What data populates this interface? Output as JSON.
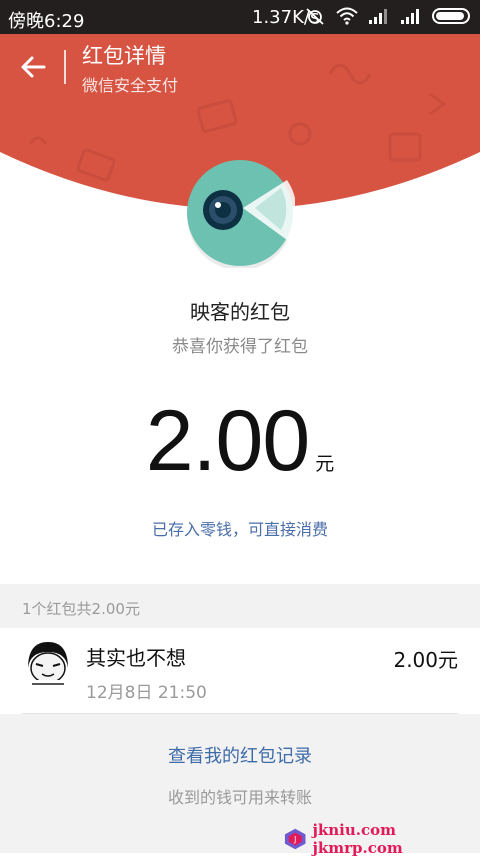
{
  "status_bar": {
    "time": "傍晚6:29",
    "network_speed": "1.37K/s",
    "icons": [
      "alarm-off-icon",
      "wifi-icon",
      "signal-icon",
      "signal-icon",
      "battery-icon"
    ]
  },
  "header": {
    "title": "红包详情",
    "subtitle": "微信安全支付",
    "back_icon": "arrow-left-icon"
  },
  "colors": {
    "header_red": "#d75443",
    "avatar_teal": "#6dc1b1",
    "link_blue": "#4a6ea9",
    "watermark_pink": "#e11b5a"
  },
  "red_packet": {
    "sender": "映客的红包",
    "greeting": "恭喜你获得了红包",
    "amount": "2.00",
    "unit": "元",
    "wallet_note": "已存入零钱，可直接消费"
  },
  "summary": {
    "text": "1个红包共2.00元"
  },
  "receivers": [
    {
      "name": "其实也不想",
      "time": "12月8日  21:50",
      "amount": "2.00元"
    }
  ],
  "footer": {
    "records_link": "查看我的红包记录",
    "transfer_note": "收到的钱可用来转账"
  },
  "watermark": {
    "text": "jkniu.com jkmrp.com"
  }
}
